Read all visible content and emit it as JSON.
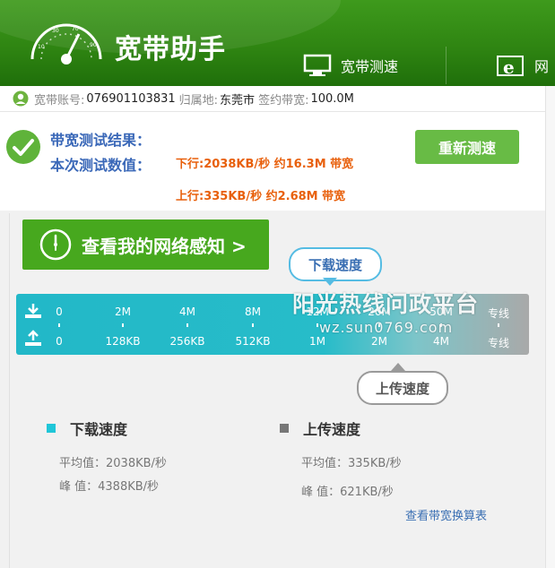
{
  "app": {
    "title": "宽带助手"
  },
  "tabs": [
    {
      "label": "宽带测速"
    },
    {
      "label": "网"
    }
  ],
  "account": {
    "account_label": "宽带账号:",
    "account_value": "076901103831",
    "location_label": "归属地:",
    "location_value": "东莞市",
    "contract_label": "签约带宽:",
    "contract_value": "100.0M"
  },
  "result": {
    "label1": "带宽测试结果：",
    "label2": "本次测试数值：",
    "download": "下行:2038KB/秒 约16.3M 带宽",
    "upload": "上行:335KB/秒 约2.68M 带宽",
    "retest_button": "重新测速"
  },
  "perceive_button": "查看我的网络感知 >",
  "bubbles": {
    "download": "下载速度",
    "upload": "上传速度"
  },
  "scale": {
    "download_ticks": [
      "0",
      "2M",
      "4M",
      "8M",
      "12M",
      "20M",
      "50M",
      "专线"
    ],
    "upload_ticks": [
      "0",
      "128KB",
      "256KB",
      "512KB",
      "1M",
      "2M",
      "4M",
      "专线"
    ]
  },
  "watermark": {
    "line1": "阳光热线问政平台",
    "line2": "wz.sun0769.com"
  },
  "stats": {
    "download": {
      "title": "下载速度",
      "avg": "平均值：2038KB/秒",
      "peak": "峰  值：4388KB/秒",
      "color": "#1fc6d8"
    },
    "upload": {
      "title": "上传速度",
      "avg": "平均值：335KB/秒",
      "peak": "峰  值：621KB/秒",
      "color": "#777777"
    }
  },
  "link": "查看带宽换算表",
  "colors": {
    "header_green": "#2f8512",
    "button_green": "#68bb45",
    "accent_orange": "#e8600c",
    "label_blue": "#3a68b8",
    "bar_teal": "#22b8c8"
  },
  "icons": {
    "logo": "speedometer-icon",
    "tab1": "monitor-icon",
    "tab2": "ie-browser-icon",
    "account": "user-icon",
    "result": "checkmark-icon",
    "perceive": "clock-icon",
    "download": "download-icon",
    "upload": "upload-icon"
  }
}
